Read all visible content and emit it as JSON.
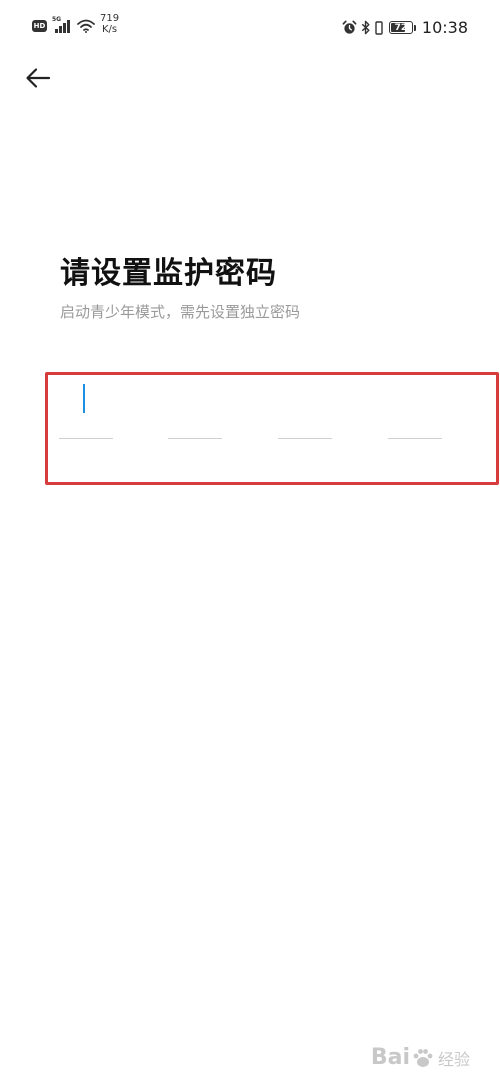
{
  "status_bar": {
    "hd_label": "HD",
    "network_label": "5G",
    "speed_value": "719",
    "speed_unit": "K/s",
    "battery_level": "72",
    "battery_percent": 72,
    "time": "10:38",
    "icons": [
      "hd-icon",
      "signal-icon",
      "wifi-icon",
      "alarm-icon",
      "bluetooth-icon",
      "battery-icon"
    ]
  },
  "nav": {
    "back_icon": "arrow-left-icon"
  },
  "page": {
    "title": "请设置监护密码",
    "subtitle": "启动青少年模式，需先设置独立密码"
  },
  "pin": {
    "length": 4,
    "digits": [
      "",
      "",
      "",
      ""
    ],
    "cursor_color": "#1e8ee0"
  },
  "highlight_color": "#d63c3c",
  "watermark": {
    "brand": "Bai",
    "suffix": "经验"
  }
}
